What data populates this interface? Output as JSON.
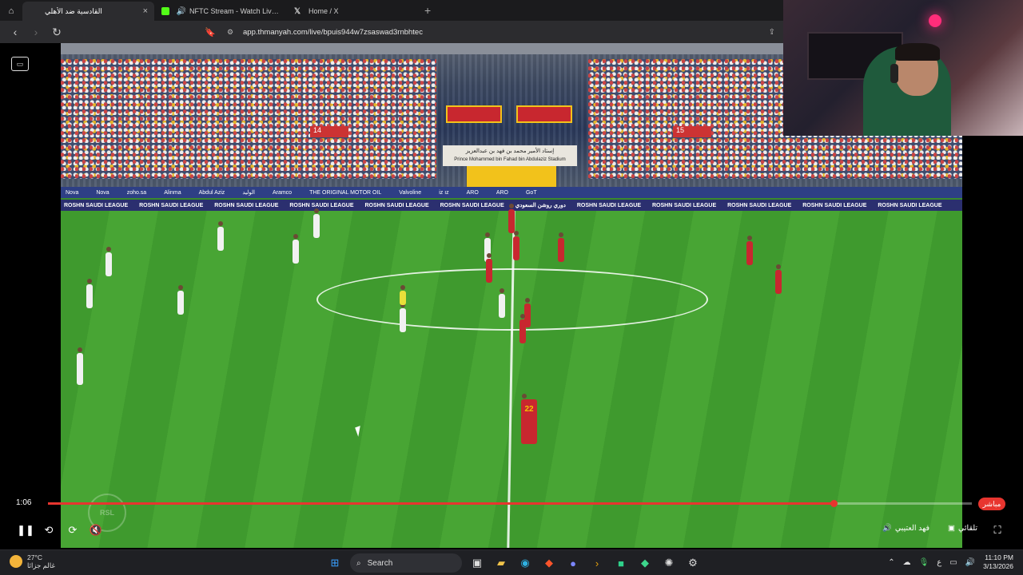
{
  "browser": {
    "tabs": [
      {
        "title": "القادسية ضد الأهلي",
        "active": true,
        "close": "×"
      },
      {
        "title": "NFTC Stream - Watch Live on Kick",
        "active": false
      },
      {
        "title": "Home / X",
        "active": false
      }
    ],
    "new_tab": "+",
    "url": "app.thmanyah.com/live/bpuis944w7zsaswad3rnbhtec"
  },
  "stadium": {
    "sign_ar": "إستاد الأمير محمد بن فهد بن عبدالعزيز",
    "sign_en": "Prince Mohammed bin Fahad bin Abdulaziz Stadium",
    "ads": [
      "Nova",
      "Nova",
      "zoho.sa",
      "Alinma",
      "Abdul Aziz",
      "الوليد",
      "Aramco",
      "THE ORIGINAL MOTOR OIL",
      "Valvoline",
      "iz ız",
      "ARO",
      "ARO",
      "GoT"
    ],
    "league_board": [
      "ROSHN SAUDI LEAGUE",
      "ROSHN SAUDI LEAGUE",
      "ROSHN SAUDI LEAGUE",
      "ROSHN SAUDI LEAGUE",
      "ROSHN SAUDI LEAGUE",
      "ROSHN SAUDI LEAGUE",
      "دوري روشن السعودي",
      "ROSHN SAUDI LEAGUE",
      "ROSHN SAUDI LEAGUE",
      "ROSHN SAUDI LEAGUE",
      "ROSHN SAUDI LEAGUE",
      "ROSHN SAUDI LEAGUE"
    ],
    "section_left": "14",
    "section_right": "15",
    "player_number": "22"
  },
  "player": {
    "current_time": "1:06",
    "progress": 0.85,
    "live_label": "مباشر",
    "commentator": "فهد العتيبي",
    "auto_label": "تلقائي",
    "rsl_logo": "RSL"
  },
  "taskbar": {
    "temperature": "27°C",
    "weather_text": "غالم جزائا",
    "search_label": "Search",
    "time": "11:10 PM",
    "date": "3/13/2026",
    "lang": "ع"
  }
}
